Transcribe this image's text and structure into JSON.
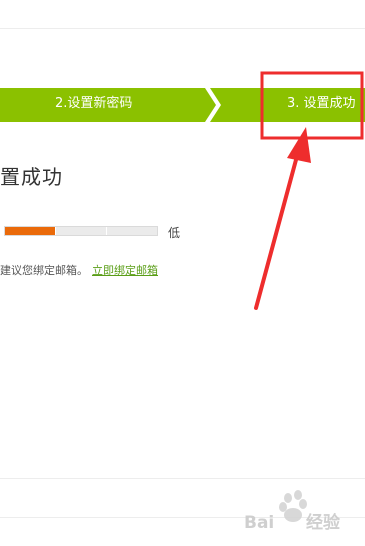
{
  "steps": [
    {
      "label": "2.设置新密码",
      "state": "done"
    },
    {
      "label": "3. 设置成功",
      "state": "current"
    }
  ],
  "heading": "置成功",
  "strength": {
    "level": "低",
    "filled_segments": 1,
    "total_segments": 3
  },
  "tip": {
    "text": "建议您绑定邮箱。",
    "link": "立即绑定邮箱"
  },
  "colors": {
    "step_green": "#8bc100",
    "strength_fill": "#ea6a0a",
    "annotation_red": "#ee2d2d",
    "link": "#5a9e17"
  },
  "watermark": {
    "text": "Baidu 经验"
  }
}
